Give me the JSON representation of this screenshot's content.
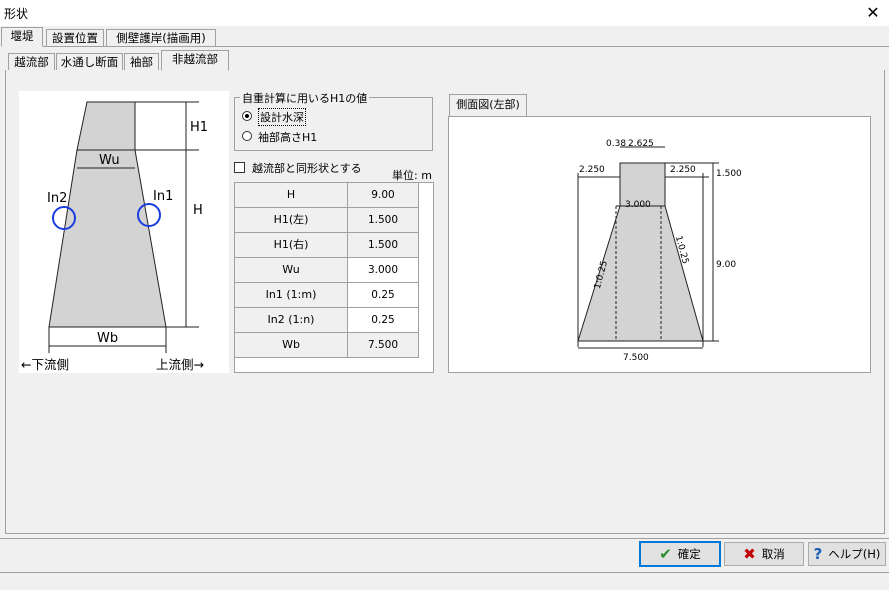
{
  "window": {
    "title": "形状",
    "close_glyph": "✕"
  },
  "tabs_main": [
    "堰堤",
    "設置位置",
    "側壁護岸(描画用)"
  ],
  "tabs_sub": [
    "越流部",
    "水通し断面",
    "袖部",
    "非越流部"
  ],
  "diagram": {
    "labels": {
      "h1": "H1",
      "h": "H",
      "wu": "Wu",
      "wb": "Wb",
      "in1": "In1",
      "in2": "In2",
      "left": "←下流側",
      "right": "上流側→"
    }
  },
  "h1_group": {
    "title": "自重計算に用いるH1の値",
    "options": [
      "設計水深",
      "袖部高さH1"
    ],
    "selected": 0
  },
  "same_shape_label": "越流部と同形状とする",
  "unit_label": "単位: m",
  "grid_rows": [
    {
      "label": "H",
      "value": "9.00",
      "editable": false
    },
    {
      "label": "H1(左)",
      "value": "1.500",
      "editable": false
    },
    {
      "label": "H1(右)",
      "value": "1.500",
      "editable": false
    },
    {
      "label": "Wu",
      "value": "3.000",
      "editable": true
    },
    {
      "label": "In1 (1:m)",
      "value": "0.25",
      "editable": true
    },
    {
      "label": "In2 (1:n)",
      "value": "0.25",
      "editable": true
    },
    {
      "label": "Wb",
      "value": "7.500",
      "editable": false
    }
  ],
  "side_view": {
    "tab_label": "側面図(左部)",
    "dims": {
      "top_a": "0.38",
      "top_b": "2.625",
      "left_off": "2.250",
      "right_off": "2.250",
      "h1": "1.500",
      "wu": "3.000",
      "h": "9.00",
      "wb": "7.500",
      "slope_left": "1:0.25",
      "slope_right": "1:0.25"
    }
  },
  "buttons": {
    "ok": "確定",
    "cancel": "取消",
    "help": "ヘルプ(H)"
  },
  "colors": {
    "fill": "#d3d3d3",
    "circle": "#1a3de0",
    "ok_check": "#2d8b2d",
    "cancel_x": "#c00000",
    "help_q": "#1a5fb4"
  }
}
